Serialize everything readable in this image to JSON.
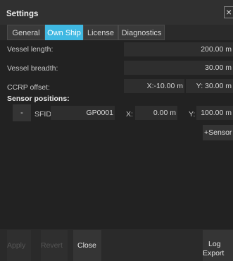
{
  "window": {
    "title": "Settings",
    "close_glyph": "×"
  },
  "tabs": [
    {
      "label": "General",
      "active": false
    },
    {
      "label": "Own Ship",
      "active": true
    },
    {
      "label": "License",
      "active": false
    },
    {
      "label": "Diagnostics",
      "active": false
    }
  ],
  "vessel": {
    "length_label": "Vessel length:",
    "length_value": "200.00 m",
    "breadth_label": "Vessel breadth:",
    "breadth_value": "30.00 m",
    "ccrp_label": "CCRP offset:",
    "ccrp_x": "X:-10.00 m",
    "ccrp_y": "Y: 30.00 m"
  },
  "sensors": {
    "heading": "Sensor positions:",
    "rows": [
      {
        "remove_label": "-",
        "sfid_label": "SFID:",
        "sfid_value": "GP0001",
        "x_label": "X:",
        "x_value": "0.00 m",
        "y_label": "Y:",
        "y_value": "100.00 m"
      }
    ],
    "add_label": "+Sensor"
  },
  "footer": {
    "apply_label": "Apply",
    "revert_label": "Revert",
    "close_label": "Close",
    "log_export_label_1": "Log",
    "log_export_label_2": "Export"
  },
  "colors": {
    "accent": "#3fb8e2",
    "background": "#222222",
    "field": "#2e2e2e"
  }
}
